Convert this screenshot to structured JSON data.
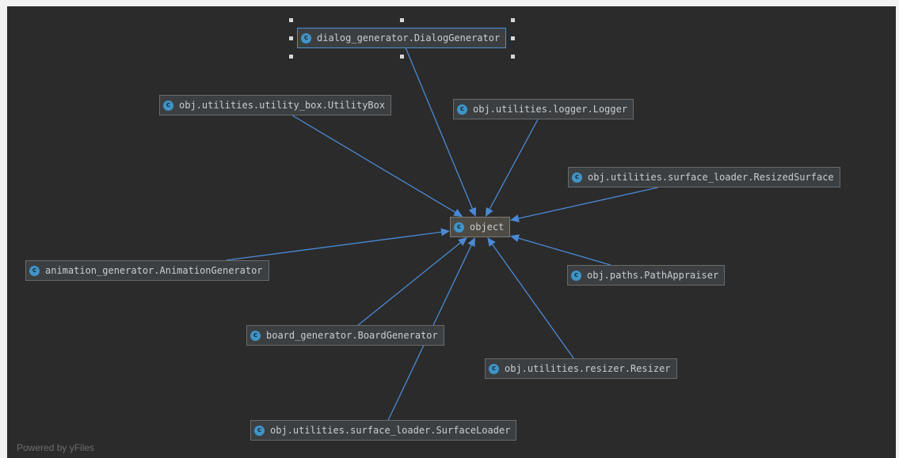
{
  "diagram": {
    "background": "#2b2b2b",
    "edge_color": "#4a8ad4",
    "icon_name": "class-c-icon",
    "icon_letter": "c",
    "center": {
      "id": "object",
      "label": "object"
    },
    "nodes": [
      {
        "id": "dialog",
        "label": "dialog_generator.DialogGenerator",
        "selected": true
      },
      {
        "id": "utility",
        "label": "obj.utilities.utility_box.UtilityBox"
      },
      {
        "id": "logger",
        "label": "obj.utilities.logger.Logger"
      },
      {
        "id": "resized",
        "label": "obj.utilities.surface_loader.ResizedSurface"
      },
      {
        "id": "animation",
        "label": "animation_generator.AnimationGenerator"
      },
      {
        "id": "paths",
        "label": "obj.paths.PathAppraiser"
      },
      {
        "id": "board",
        "label": "board_generator.BoardGenerator"
      },
      {
        "id": "resizer",
        "label": "obj.utilities.resizer.Resizer"
      },
      {
        "id": "surface",
        "label": "obj.utilities.surface_loader.SurfaceLoader"
      }
    ],
    "edges": [
      {
        "from": "dialog",
        "to": "object"
      },
      {
        "from": "utility",
        "to": "object"
      },
      {
        "from": "logger",
        "to": "object"
      },
      {
        "from": "resized",
        "to": "object"
      },
      {
        "from": "animation",
        "to": "object"
      },
      {
        "from": "paths",
        "to": "object"
      },
      {
        "from": "board",
        "to": "object"
      },
      {
        "from": "resizer",
        "to": "object"
      },
      {
        "from": "surface",
        "to": "object"
      }
    ],
    "powered_by": "Powered by yFiles"
  }
}
